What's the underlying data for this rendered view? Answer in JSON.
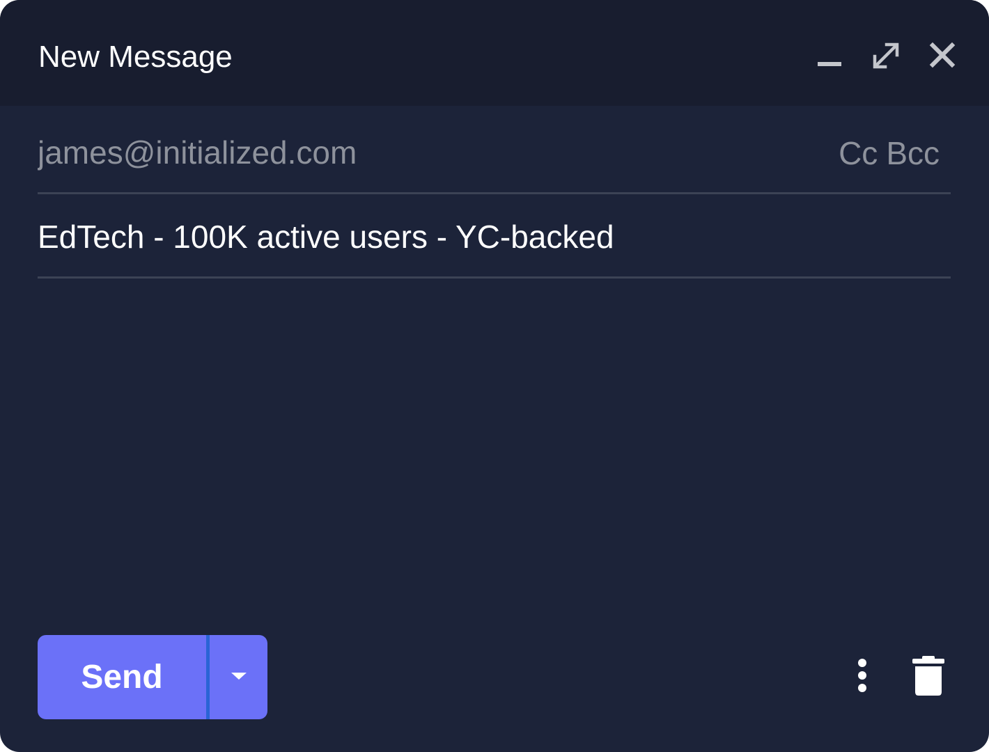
{
  "window": {
    "title": "New Message",
    "controls": [
      "minimize-icon",
      "expand-icon",
      "close-icon"
    ]
  },
  "compose": {
    "to_value": "james@initialized.com",
    "cc_label": "Cc",
    "bcc_label": "Bcc",
    "subject_value": "EdTech - 100K active users - YC-backed",
    "body_value": ""
  },
  "footer": {
    "send_label": "Send",
    "send_options_icon": "chevron-down-icon",
    "more_icon": "more-vertical-icon",
    "discard_icon": "trash-icon"
  },
  "colors": {
    "window_bg": "#1c2339",
    "titlebar_bg": "#181d2f",
    "accent": "#6b71f8",
    "divider": "#3c4355",
    "muted_text": "#8e929c"
  }
}
